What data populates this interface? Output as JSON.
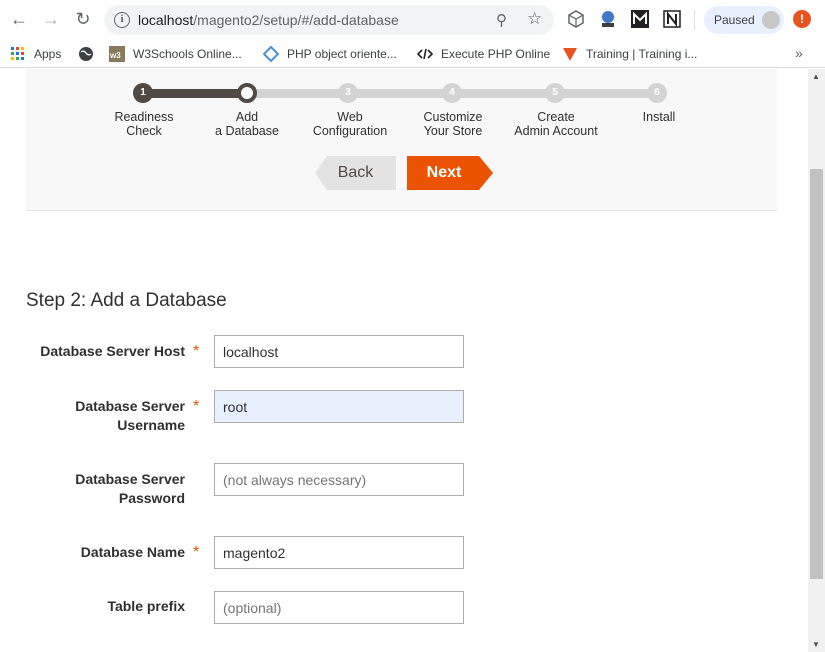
{
  "browser": {
    "url_host": "localhost",
    "url_path": "/magento2/setup/#/add-database",
    "paused_label": "Paused",
    "bookmarks": [
      {
        "label": "Apps"
      },
      {
        "label": ""
      },
      {
        "label": "W3Schools Online..."
      },
      {
        "label": "PHP object oriente..."
      },
      {
        "label": "Execute PHP Online"
      },
      {
        "label": "Training | Training i..."
      }
    ]
  },
  "wizard": {
    "steps": [
      {
        "number": "1",
        "label_line1": "Readiness",
        "label_line2": "Check"
      },
      {
        "number": "2",
        "label_line1": "Add",
        "label_line2": "a Database"
      },
      {
        "number": "3",
        "label_line1": "Web",
        "label_line2": "Configuration"
      },
      {
        "number": "4",
        "label_line1": "Customize",
        "label_line2": "Your Store"
      },
      {
        "number": "5",
        "label_line1": "Create",
        "label_line2": "Admin Account"
      },
      {
        "number": "6",
        "label_line1": "Install",
        "label_line2": ""
      }
    ],
    "current_step": 2,
    "back_label": "Back",
    "next_label": "Next"
  },
  "form": {
    "title": "Step 2: Add a Database",
    "fields": [
      {
        "label_line1": "Database Server Host",
        "label_line2": "",
        "required": "*",
        "value": "localhost",
        "placeholder": ""
      },
      {
        "label_line1": "Database Server",
        "label_line2": "Username",
        "required": "*",
        "value": "root",
        "placeholder": ""
      },
      {
        "label_line1": "Database Server",
        "label_line2": "Password",
        "required": "",
        "value": "",
        "placeholder": "(not always necessary)"
      },
      {
        "label_line1": "Database Name",
        "label_line2": "",
        "required": "*",
        "value": "magento2",
        "placeholder": ""
      },
      {
        "label_line1": "Table prefix",
        "label_line2": "",
        "required": "",
        "value": "",
        "placeholder": "(optional)"
      }
    ]
  },
  "colors": {
    "accent": "#eb5202",
    "progress": "#514943"
  }
}
